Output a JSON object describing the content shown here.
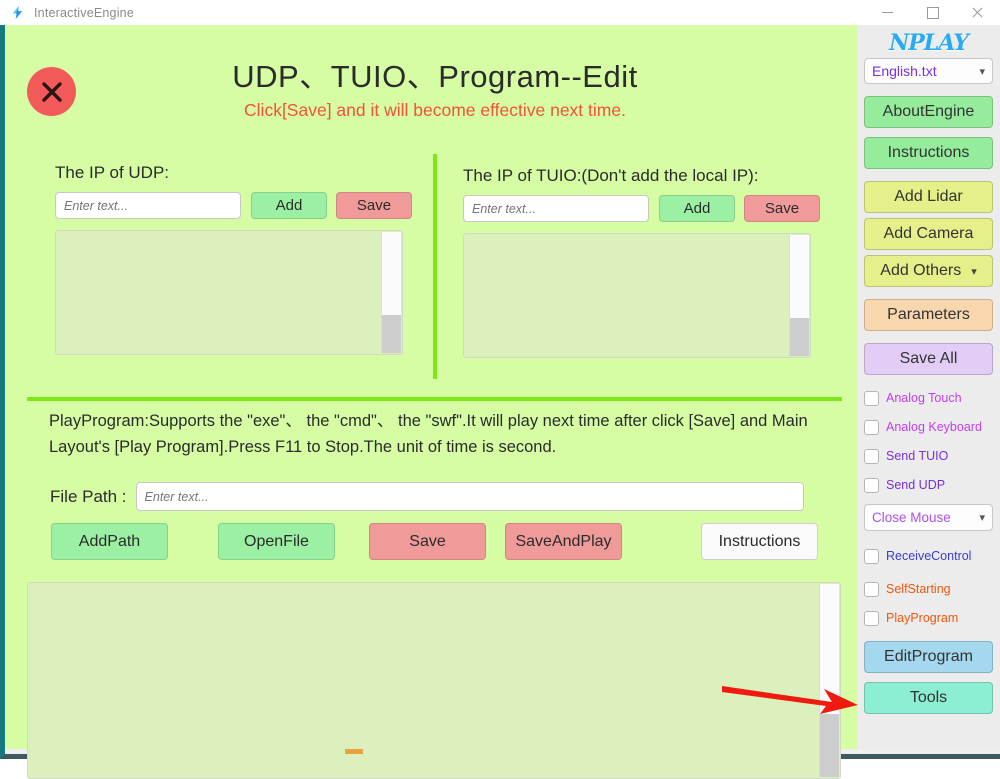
{
  "window": {
    "app_title": "InteractiveEngine",
    "app_icon": "lightning-bolt-icon",
    "minimize": "minimize-icon",
    "maximize": "maximize-icon",
    "close": "close-icon"
  },
  "header": {
    "close_circle_icon": "x-circle-icon",
    "title": "UDP、TUIO、Program--Edit",
    "subtitle": "Click[Save] and it will become effective next time."
  },
  "udp": {
    "label": "The IP of UDP:",
    "input_value": "",
    "input_placeholder": "Enter text...",
    "add_label": "Add",
    "save_label": "Save",
    "list_items": []
  },
  "tuio": {
    "label": "The IP of TUIO:(Don't add the local IP):",
    "input_value": "",
    "input_placeholder": "Enter text...",
    "add_label": "Add",
    "save_label": "Save",
    "list_items": []
  },
  "program": {
    "description": "PlayProgram:Supports the \"exe\"、 the \"cmd\"、 the \"swf\".It will play next time after click [Save] and Main Layout's [Play Program].Press F11 to Stop.The unit of time is second.",
    "file_path_label": "File Path :",
    "file_path_value": "",
    "file_path_placeholder": "Enter text...",
    "buttons": [
      {
        "name": "addpath-button",
        "label": "AddPath"
      },
      {
        "name": "openfile-button",
        "label": "OpenFile"
      },
      {
        "name": "save-button",
        "label": "Save"
      },
      {
        "name": "saveandplay-button",
        "label": "SaveAndPlay"
      },
      {
        "name": "instructions-button",
        "label": "Instructions"
      }
    ],
    "list_items": []
  },
  "sidebar": {
    "logo": "NPLAY",
    "language_select": {
      "value": "English.txt",
      "chevron": "chevron-down-icon"
    },
    "buttons": [
      {
        "label": "AboutEngine"
      },
      {
        "label": "Instructions"
      },
      {
        "label": "Add Lidar"
      },
      {
        "label": "Add Camera"
      },
      {
        "label": "Add Others"
      },
      {
        "label": "Parameters"
      },
      {
        "label": "Save All"
      }
    ],
    "add_others_chevron": "chevron-down-icon",
    "checkboxes": [
      {
        "label": "Analog Touch",
        "checked": false
      },
      {
        "label": "Analog Keyboard",
        "checked": false
      },
      {
        "label": "Send TUIO",
        "checked": false
      },
      {
        "label": "Send UDP",
        "checked": false
      }
    ],
    "mouse_select": {
      "value": "Close Mouse",
      "chevron": "chevron-down-icon"
    },
    "checkboxes2": [
      {
        "label": "ReceiveControl",
        "checked": false
      },
      {
        "label": "SelfStarting",
        "checked": false
      },
      {
        "label": "PlayProgram",
        "checked": false
      }
    ],
    "edit_program_label": "EditProgram",
    "tools_label": "Tools"
  },
  "annotation": {
    "arrow": "red-arrow-pointing-right",
    "arrow_color": "#ee1b0e"
  },
  "colors": {
    "main_bg": "#d6fda4",
    "sidebar_bg": "#ececec",
    "accent_green": "#7ce818",
    "green_button": "#9bf0a3",
    "red_button": "#f09a9a",
    "yellow_button": "#e5f08a",
    "orange_button": "#f8d6ae",
    "purple_button": "#e3cdf6",
    "blue_button": "#a4d8ef",
    "teal_button": "#8ceed2",
    "logo_blue": "#29abf2",
    "subtitle_red": "#f4513b",
    "frame_teal": "#157a7f"
  }
}
